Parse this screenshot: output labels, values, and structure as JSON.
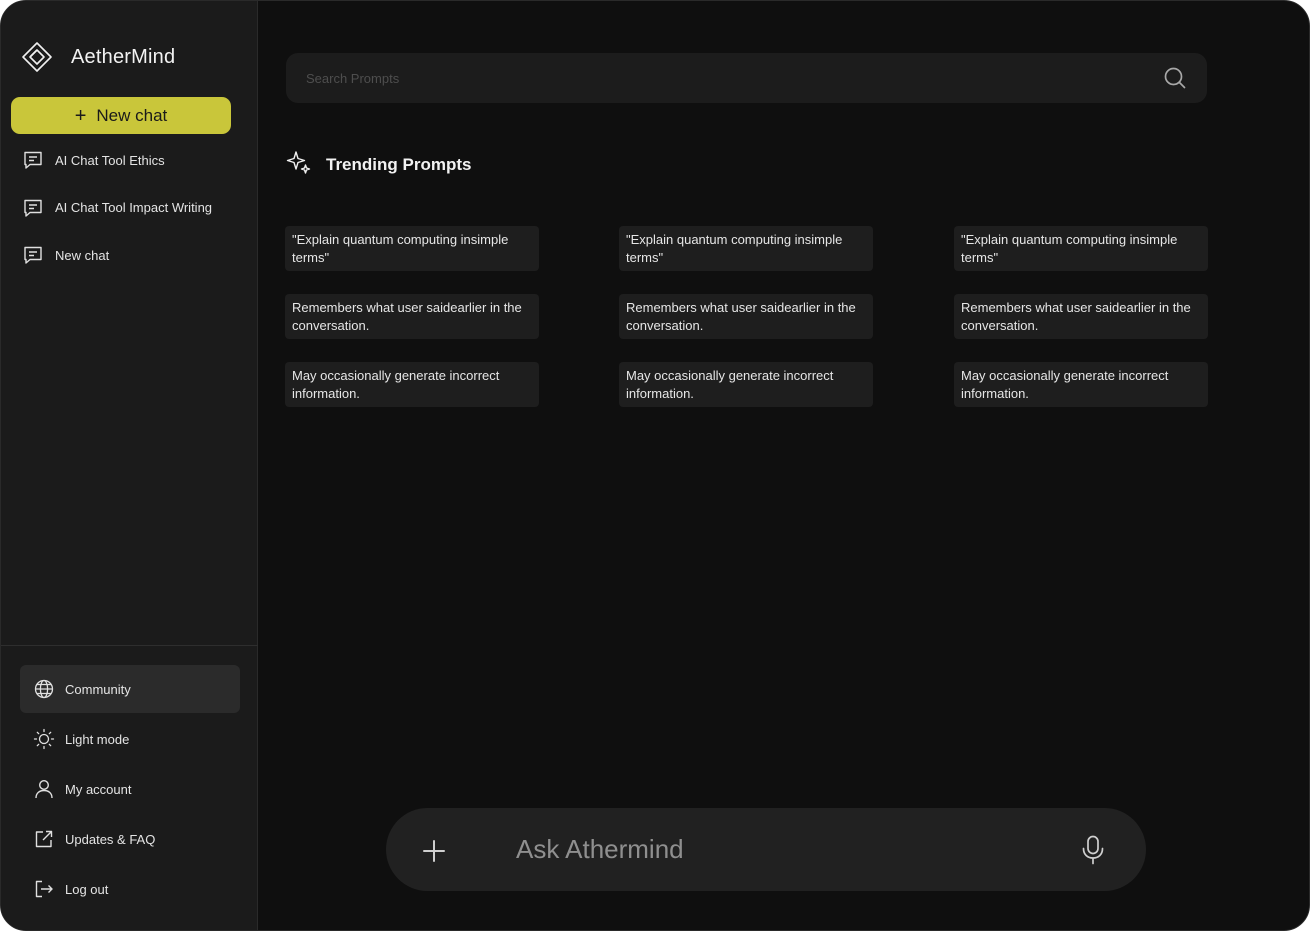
{
  "app": {
    "name": "AetherMind"
  },
  "sidebar": {
    "new_chat_label": "New chat",
    "history": [
      {
        "label": "AI Chat Tool Ethics",
        "icon": "chat-icon"
      },
      {
        "label": "AI Chat Tool Impact Writing",
        "icon": "chat-icon"
      },
      {
        "label": "New chat",
        "icon": "chat-icon"
      }
    ],
    "menu": [
      {
        "label": "Community",
        "icon": "globe-icon",
        "active": true
      },
      {
        "label": "Light mode",
        "icon": "sun-icon",
        "active": false
      },
      {
        "label": "My  account",
        "icon": "user-icon",
        "active": false
      },
      {
        "label": "Updates & FAQ",
        "icon": "external-link-icon",
        "active": false
      },
      {
        "label": "Log out",
        "icon": "logout-icon",
        "active": false
      }
    ]
  },
  "search": {
    "placeholder": "Search Prompts"
  },
  "trending": {
    "title": "Trending Prompts",
    "cards": [
      [
        "\"Explain quantum computing insimple terms\"",
        "\"Explain quantum computing insimple terms\"",
        "\"Explain quantum computing insimple terms\""
      ],
      [
        "Remembers what user saidearlier in the conversation.",
        "Remembers what user saidearlier in the conversation.",
        "Remembers what user saidearlier in the conversation."
      ],
      [
        "May occasionally generate incorrect information.",
        "May occasionally generate incorrect information.",
        "May occasionally generate incorrect information."
      ]
    ]
  },
  "composer": {
    "placeholder": "Ask Athermind"
  },
  "colors": {
    "accent": "#c9c63a",
    "background": "#0f0f0f",
    "sidebar": "#1b1b1b",
    "card": "#1e1e1e"
  }
}
